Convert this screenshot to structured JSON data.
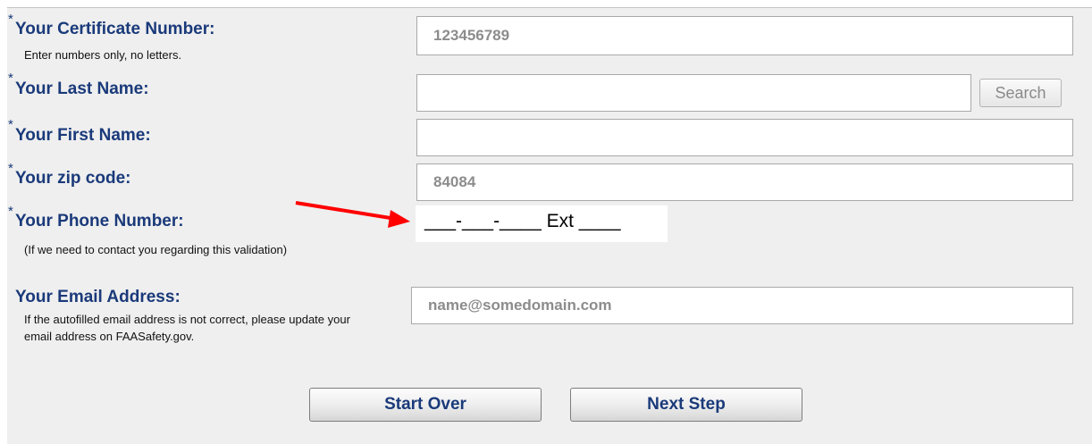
{
  "form": {
    "required_marker": "*",
    "certificate": {
      "label": "Your Certificate Number:",
      "help": "Enter numbers only, no letters.",
      "value": "123456789"
    },
    "last_name": {
      "label": "Your Last Name:",
      "value": "",
      "search_label": "Search"
    },
    "first_name": {
      "label": "Your First Name:",
      "value": ""
    },
    "zip": {
      "label": "Your zip code:",
      "value": "84084"
    },
    "phone": {
      "label": "Your Phone Number:",
      "help": "(If we need to contact you regarding this validation)",
      "mask": "___-___-____  Ext ____"
    },
    "email": {
      "label": "Your Email Address:",
      "help": "If the autofilled email address is not correct, please update your email address on FAASafety.gov.",
      "value": "name@somedomain.com"
    },
    "buttons": {
      "start_over": "Start Over",
      "next_step": "Next Step"
    }
  },
  "annotation": {
    "arrow_color": "#ff0000"
  }
}
